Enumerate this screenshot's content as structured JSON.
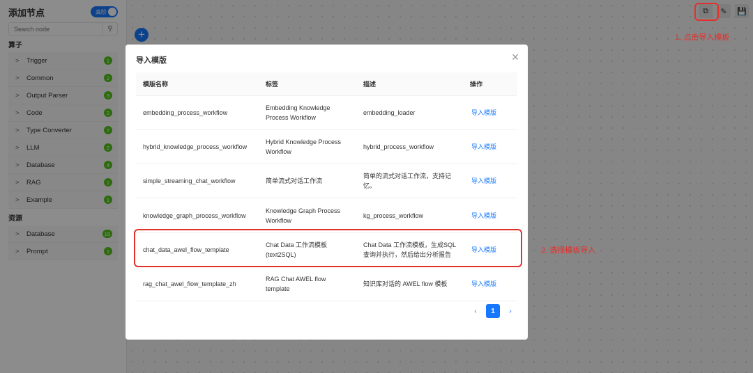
{
  "sidebar": {
    "title": "添加节点",
    "toggle_label": "高阶",
    "search_placeholder": "Search node",
    "operators_label": "算子",
    "operators": [
      {
        "label": "Trigger",
        "count": "1"
      },
      {
        "label": "Common",
        "count": "2"
      },
      {
        "label": "Output Parser",
        "count": "3"
      },
      {
        "label": "Code",
        "count": "2"
      },
      {
        "label": "Type Converter",
        "count": "7"
      },
      {
        "label": "LLM",
        "count": "2"
      },
      {
        "label": "Database",
        "count": "4"
      },
      {
        "label": "RAG",
        "count": "1"
      },
      {
        "label": "Example",
        "count": "1"
      }
    ],
    "resources_label": "资源",
    "resources": [
      {
        "label": "Database",
        "count": "15"
      },
      {
        "label": "Prompt",
        "count": "1"
      }
    ]
  },
  "modal": {
    "title": "导入模版",
    "headers": [
      "模版名称",
      "标签",
      "描述",
      "操作"
    ],
    "rows": [
      {
        "name": "embedding_process_workflow",
        "tag": "Embedding Knowledge Process Workflow",
        "desc": "embedding_loader",
        "action": "导入模版"
      },
      {
        "name": "hybrid_knowledge_process_workflow",
        "tag": "Hybrid Knowledge Process Workflow",
        "desc": "hybrid_process_workflow",
        "action": "导入模版"
      },
      {
        "name": "simple_streaming_chat_workflow",
        "tag": "简单流式对话工作流",
        "desc": "简单的流式对话工作流，支持记忆。",
        "action": "导入模版"
      },
      {
        "name": "knowledge_graph_process_workflow",
        "tag": "Knowledge Graph Process Workflow",
        "desc": "kg_process_workflow",
        "action": "导入模版"
      },
      {
        "name": "chat_data_awel_flow_template",
        "tag": "Chat Data 工作流模板 (text2SQL)",
        "desc": "Chat Data 工作流模板，生成SQL查询并执行，然后给出分析报告",
        "action": "导入模版"
      },
      {
        "name": "rag_chat_awel_flow_template_zh",
        "tag": "RAG Chat AWEL flow template",
        "desc": "知识库对话的 AWEL flow 模板",
        "action": "导入模版"
      }
    ],
    "page": "1"
  },
  "annotations": {
    "step1": "1. 点击导入模板",
    "step2": "2. 选择模板导入"
  },
  "colors": {
    "accent": "#1677ff",
    "annotation": "#e5302a",
    "badge": "#52c41a"
  }
}
